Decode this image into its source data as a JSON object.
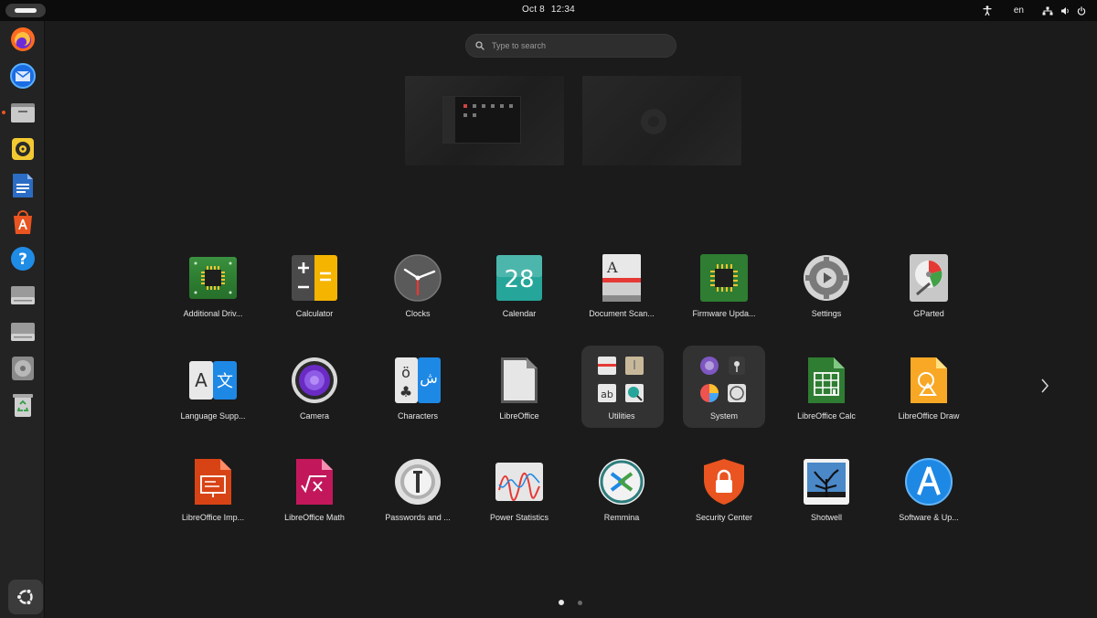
{
  "topbar": {
    "date": "Oct 8",
    "time": "12:34",
    "language": "en",
    "icons": [
      "accessibility-icon",
      "network-icon",
      "power-icon"
    ]
  },
  "dock": {
    "items": [
      "firefox",
      "thunderbird",
      "files",
      "rhythmbox",
      "libreoffice-writer",
      "app-center",
      "help",
      "drive",
      "drive",
      "disc",
      "trash"
    ],
    "show_apps_icon": "ubuntu-logo-icon"
  },
  "search": {
    "placeholder": "Type to search"
  },
  "apps": {
    "additional_drivers": "Additional Driv...",
    "calculator": "Calculator",
    "clocks": "Clocks",
    "calendar": "Calendar",
    "calendar_day": "28",
    "document_scanner": "Document Scan...",
    "firmware_updater": "Firmware Upda...",
    "settings": "Settings",
    "gparted": "GParted",
    "language_support": "Language Supp...",
    "camera": "Camera",
    "characters": "Characters",
    "libreoffice": "LibreOffice",
    "utilities": "Utilities",
    "system": "System",
    "libreoffice_calc": "LibreOffice Calc",
    "libreoffice_draw": "LibreOffice Draw",
    "libreoffice_impress": "LibreOffice Imp...",
    "libreoffice_math": "LibreOffice Math",
    "passwords": "Passwords and ...",
    "power_statistics": "Power Statistics",
    "remmina": "Remmina",
    "security_center": "Security Center",
    "shotwell": "Shotwell",
    "software_updater": "Software & Up..."
  },
  "pages": {
    "count": 2,
    "current": 1
  },
  "colors": {
    "accent": "#e95420",
    "background": "#1b1b1b",
    "topbar": "#0c0c0c",
    "dock": "#232323"
  }
}
